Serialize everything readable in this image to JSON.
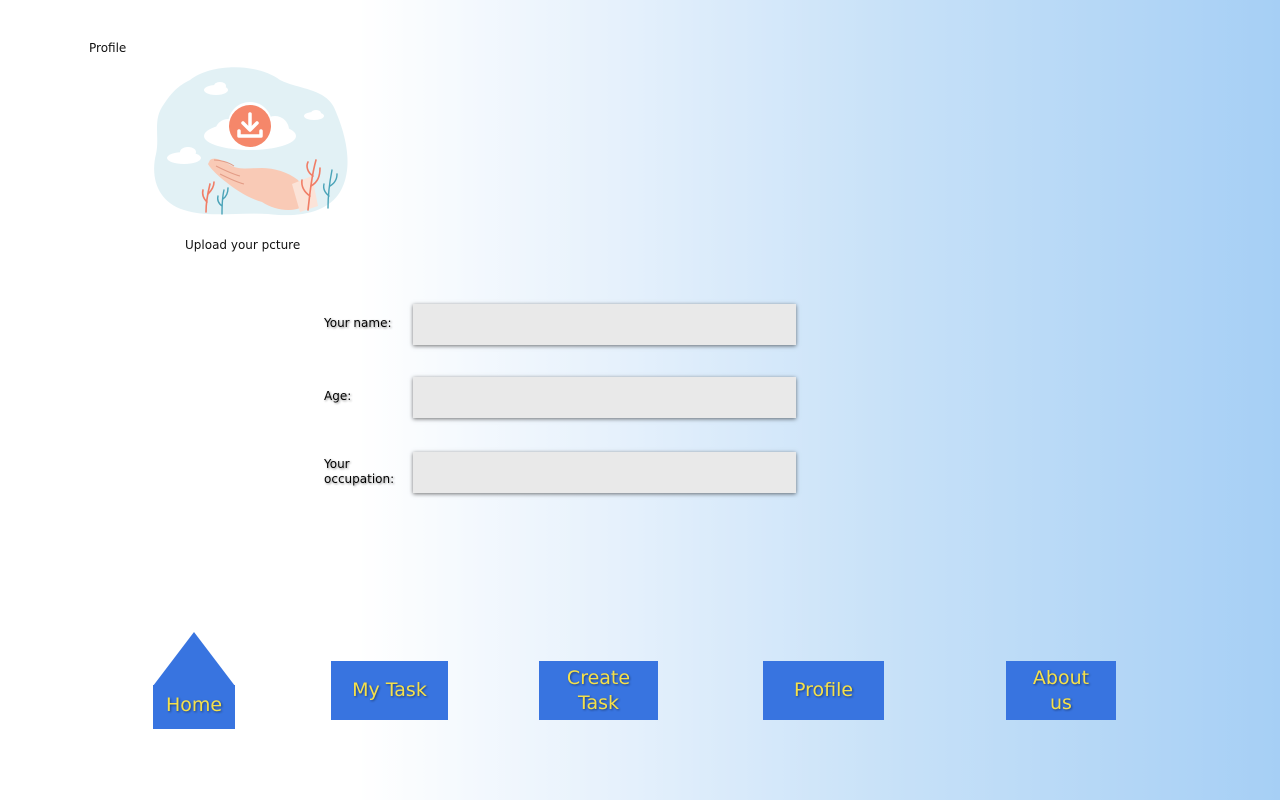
{
  "header": {
    "page_title": "Profile"
  },
  "upload": {
    "caption": "Upload your pcture"
  },
  "form": {
    "name_label": "Your name:",
    "name_value": "",
    "age_label": "Age:",
    "age_value": "",
    "occupation_label": "Your occupation:",
    "occupation_value": ""
  },
  "nav": {
    "home": "Home",
    "my_task": "My Task",
    "create_task": "Create Task",
    "profile": "Profile",
    "about_us": "About us"
  },
  "colors": {
    "nav_button": "#3874e0",
    "nav_text": "#f5e04a",
    "input_bg": "#e9e9e9",
    "upload_accent": "#f5876a"
  }
}
